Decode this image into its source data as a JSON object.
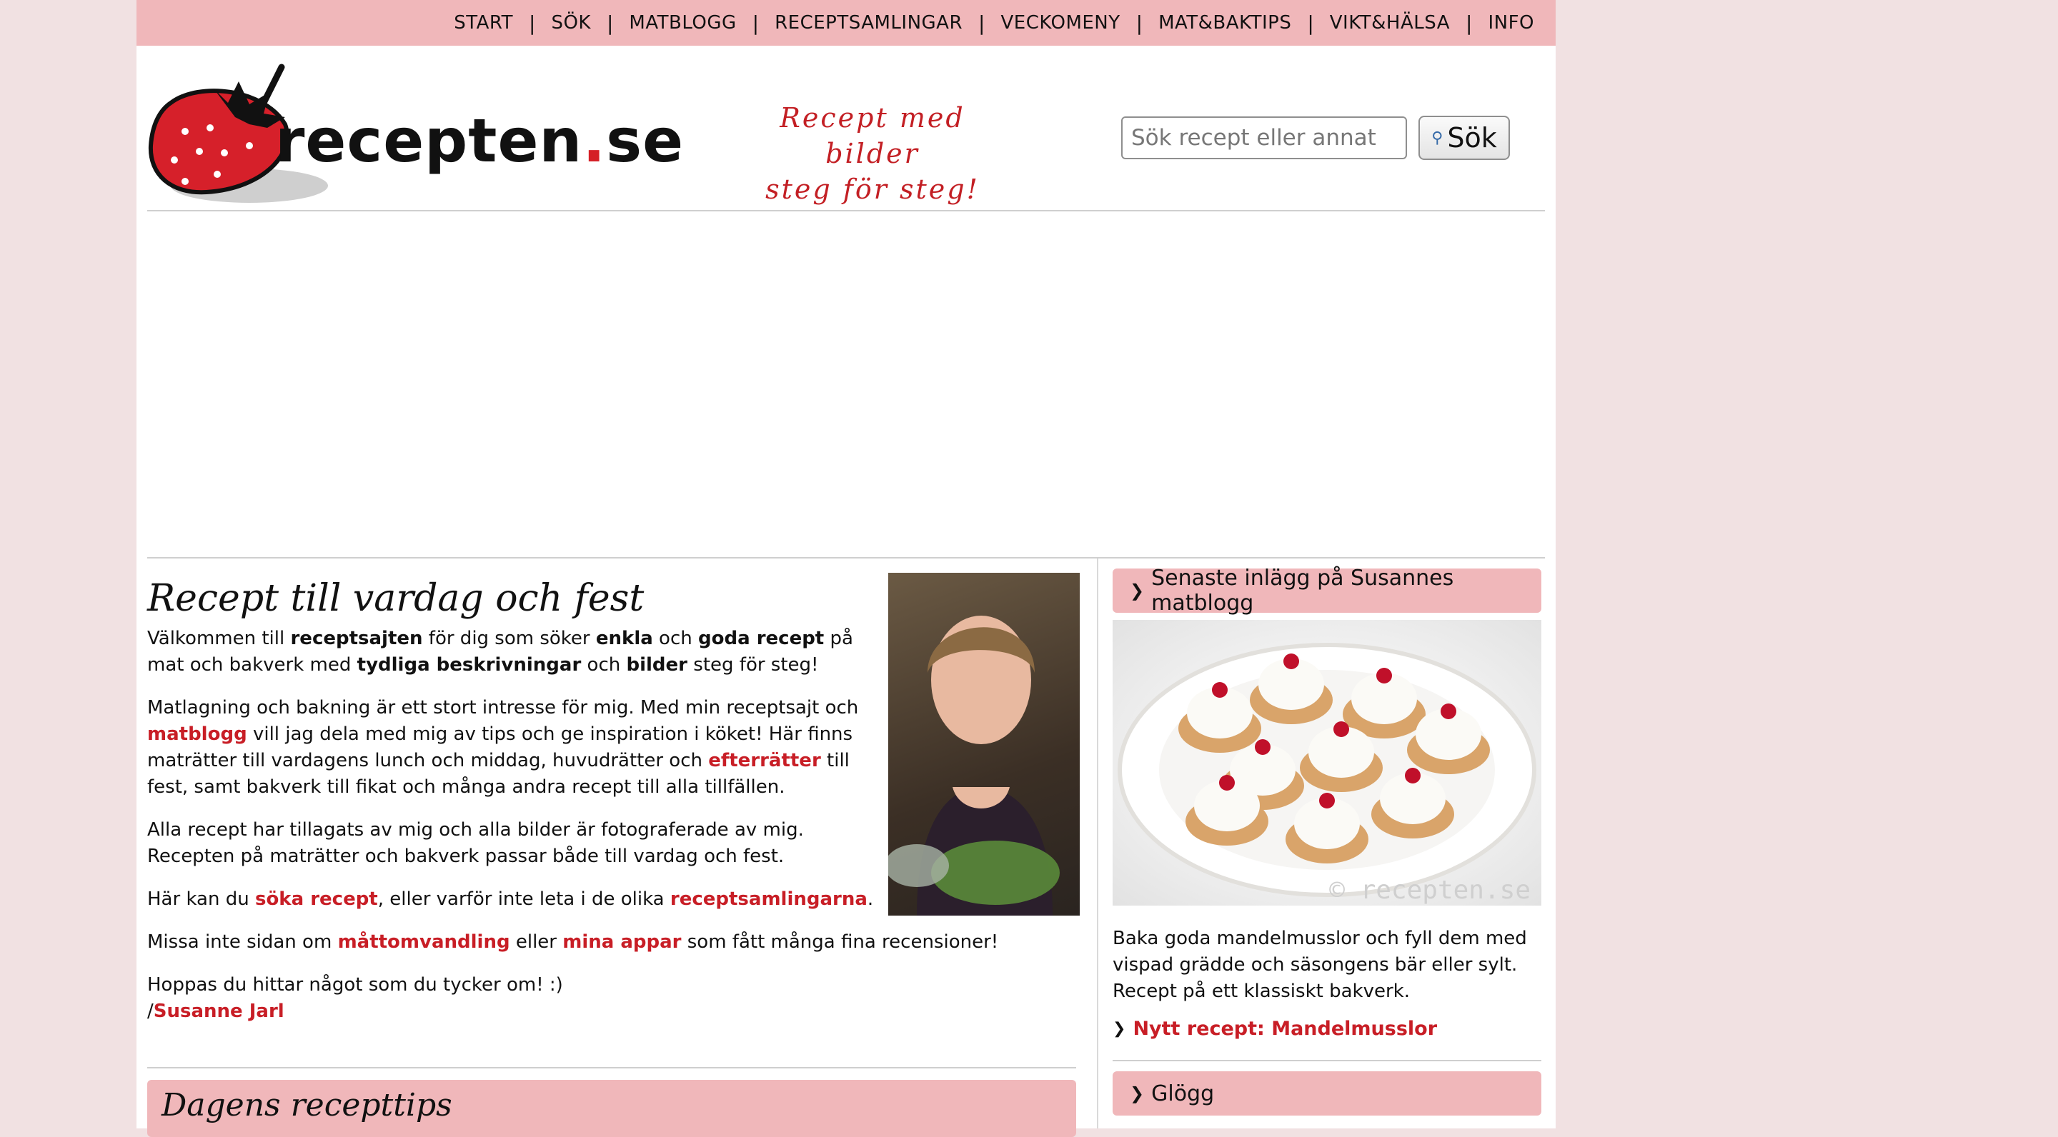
{
  "nav": [
    "START",
    "SÖK",
    "MATBLOGG",
    "RECEPTSAMLINGAR",
    "VECKOMENY",
    "MAT&BAKTIPS",
    "VIKT&HÄLSA",
    "INFO"
  ],
  "logo": {
    "name": "recepten",
    "tld": "se"
  },
  "tagline": {
    "line1": "Recept med bilder",
    "line2": "steg för steg!"
  },
  "search": {
    "placeholder": "Sök recept eller annat",
    "button": "Sök"
  },
  "main": {
    "title": "Recept till vardag och fest",
    "p1": {
      "a": "Välkommen till ",
      "b1": "receptsajten",
      "c": " för dig som söker ",
      "b2": "enkla",
      "d": " och ",
      "b3": "goda recept",
      "e": " på mat och bakverk med ",
      "b4": "tydliga beskrivningar",
      "f": " och ",
      "b5": "bilder",
      "g": " steg för steg!"
    },
    "p2": {
      "a": "Matlagning och bakning är ett stort intresse för mig. Med min receptsajt och ",
      "link1": "matblogg",
      "b": " vill jag dela med mig av tips och ge inspiration i köket! Här finns maträtter till vardagens lunch och middag, huvudrätter och ",
      "link2": "efterrätter",
      "c": " till fest, samt bakverk till fikat och många andra recept till alla tillfällen."
    },
    "p3": "Alla recept har tillagats av mig och alla bilder är fotograferade av mig. Recepten på maträtter och bakverk passar både till vardag och fest.",
    "p4": {
      "a": "Här kan du ",
      "link1": "söka recept",
      "b": ", eller varför inte leta i de olika ",
      "link2": "receptsamlingarna",
      "c": "."
    },
    "p5": {
      "a": "Missa inte sidan om ",
      "link1": "måttomvandling",
      "b": " eller ",
      "link2": "mina appar",
      "c": " som fått många fina recensioner!"
    },
    "p6": {
      "a": "Hoppas du hittar något som du tycker om! :)",
      "slash": "/",
      "link": "Susanne Jarl"
    },
    "tips_title": "Dagens recepttips"
  },
  "sidebar": {
    "heading": "Senaste inlägg på Susannes matblogg",
    "watermark": "© recepten.se",
    "text": "Baka goda mandelmusslor och fyll dem med vispad grädde och säsongens bär eller sylt. Recept på ett klassiskt bakverk.",
    "link": "Nytt recept: Mandelmusslor",
    "heading2": "Glögg"
  },
  "colors": {
    "accent": "#c81e26",
    "nav_bg": "#f0b7ba",
    "page_bg": "#f1e1e2"
  }
}
